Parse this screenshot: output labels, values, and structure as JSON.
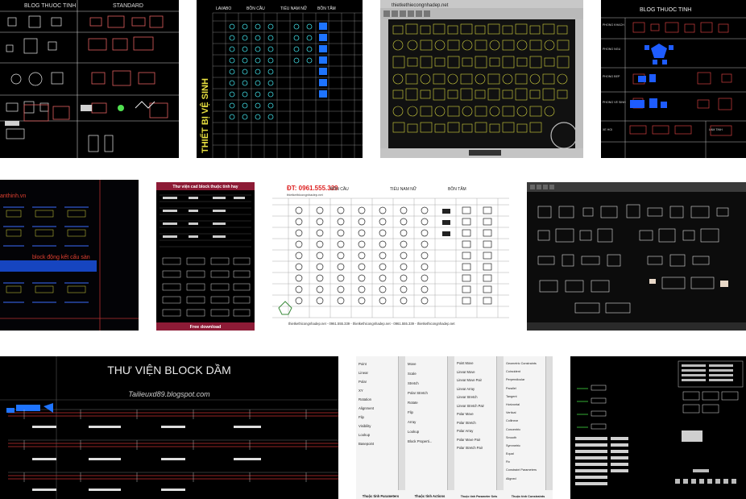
{
  "results": [
    {
      "id": "t1",
      "texts": {
        "title": "BLOG THUOC TINH",
        "subtitle": "STANDARD"
      }
    },
    {
      "id": "t2",
      "texts": {
        "cat1": "LAVABO",
        "cat2": "BỒN CẦU",
        "cat3": "TIỂU NAM NỮ",
        "cat4": "BỒN TẮM",
        "vertical": "THIẾT BỊ VỆ SINH"
      }
    },
    {
      "id": "t3",
      "texts": {
        "titlebar": "thietkethiecongnhadep.net"
      }
    },
    {
      "id": "t4",
      "texts": {
        "title": "BLOG THUOC TINH",
        "row1": "PHONG KHACH",
        "row2": "PHONG NGU",
        "row3": "PHONG BEP",
        "row4": "PHONG VE SINH",
        "row5": "XE HOI",
        "row6": "LAM TINH"
      }
    },
    {
      "id": "t5",
      "texts": {
        "site": "anthinh.vn",
        "caption": "block động kết cấu sàn"
      }
    },
    {
      "id": "t6",
      "texts": {
        "header": "Thư viện cad block thuộc tính hay",
        "footer": "Free download"
      }
    },
    {
      "id": "t7",
      "texts": {
        "phone": "ĐT: 0961.555.339",
        "cat1": "BỒN CẦU",
        "cat2": "TIỂU NAM NỮ",
        "cat3": "BỒN TẮM",
        "website": "thietkethicongnhadep.net",
        "footer": "thietkethicongnhadep.net - 0961.555.339 - thietkethicongnhadep.net - 0961.555.339 - thietkethicongnhadep.net"
      }
    },
    {
      "id": "t8",
      "texts": {}
    },
    {
      "id": "t9",
      "texts": {
        "title": "THƯ VIỆN BLOCK DẦM",
        "site": "Tailieuxd89.blogspot.com"
      }
    },
    {
      "id": "t10",
      "texts": {
        "col1_title": "Thuộc tính Parameters",
        "col2_title": "Thuộc tính Actions",
        "col3_title": "Thuộc tính Parameter Sets",
        "col4_title": "Thuộc tính Constraints",
        "col1_items": [
          "Point",
          "Linear",
          "Polar",
          "XY",
          "Rotation",
          "Alignment",
          "Flip",
          "Visibility",
          "Lookup",
          "Basepoint"
        ],
        "col2_items": [
          "Move",
          "Scale",
          "Stretch",
          "Polar Stretch",
          "Rotate",
          "Flip",
          "Array",
          "Lookup",
          "Block Properti..."
        ],
        "col3_items": [
          "Point Move",
          "Linear Move",
          "Linear Move Pair",
          "Linear Array",
          "Linear Stretch",
          "Linear Stretch Pair",
          "Polar Move",
          "Polar Stretch",
          "Polar Array",
          "Polar Move Pair",
          "Polar Stretch Pair"
        ],
        "col4_items": [
          "Geometric Constraints",
          "Coincident",
          "Perpendicular",
          "Parallel",
          "Tangent",
          "Horizontal",
          "Vertical",
          "Collinear",
          "Concentric",
          "Smooth",
          "Symmetric",
          "Equal",
          "Fix",
          "Constraint Parameters",
          "Aligned"
        ]
      }
    },
    {
      "id": "t11",
      "texts": {}
    }
  ],
  "colors": {
    "cad_bg": "#050505",
    "cad_yellow": "#d8d840",
    "cad_cyan": "#40d8e0",
    "cad_red": "#c83030",
    "cad_blue": "#2060ff"
  }
}
